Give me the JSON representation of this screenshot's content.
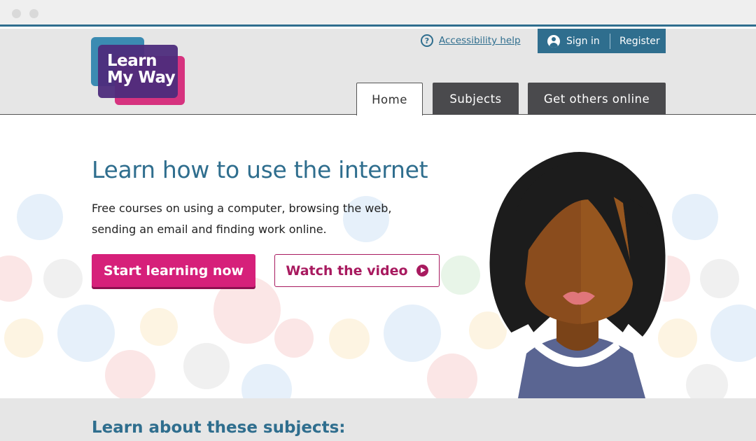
{
  "header": {
    "logo_text_line1": "Learn",
    "logo_text_line2": "My Way",
    "accessibility_help": "Accessibility help",
    "sign_in": "Sign in",
    "register": "Register"
  },
  "nav": {
    "tabs": [
      {
        "label": "Home",
        "active": true
      },
      {
        "label": "Subjects",
        "active": false
      },
      {
        "label": "Get others online",
        "active": false
      }
    ]
  },
  "hero": {
    "title": "Learn how to use the internet",
    "description": "Free courses on using a computer, browsing the web, sending an email and finding work online.",
    "primary_button": "Start learning now",
    "secondary_button": "Watch the video"
  },
  "subjects": {
    "title": "Learn about these subjects:"
  },
  "colors": {
    "brand_blue": "#2f6e8e",
    "brand_pink": "#d6207a",
    "brand_purple": "#4d2c7c",
    "tab_dark": "#4a4a4d"
  },
  "icons": [
    "help-icon",
    "user-icon",
    "play-icon",
    "wifi-icon",
    "mail-icon",
    "home-icon",
    "heart-icon",
    "power-icon",
    "people-icon",
    "hand-icon"
  ]
}
